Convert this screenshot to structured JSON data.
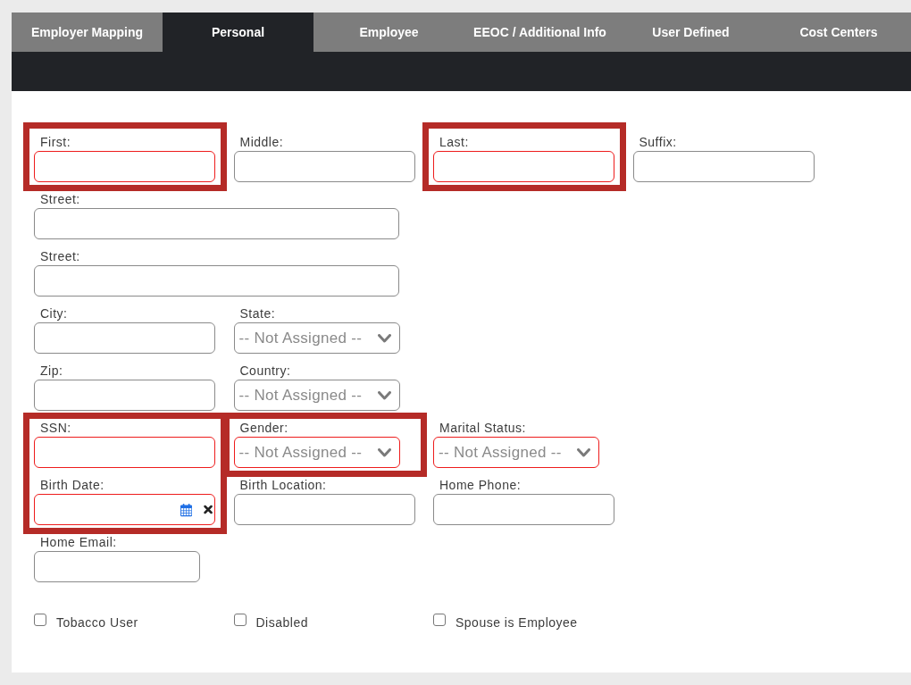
{
  "tabs": [
    {
      "label": "Employer Mapping",
      "selected": false
    },
    {
      "label": "Personal",
      "selected": true
    },
    {
      "label": "Employee",
      "selected": false
    },
    {
      "label": "EEOC / Additional Info",
      "selected": false
    },
    {
      "label": "User Defined",
      "selected": false
    },
    {
      "label": "Cost Centers",
      "selected": false
    }
  ],
  "form": {
    "rows": [
      {
        "fields": [
          {
            "kind": "text",
            "label": "First:",
            "required": true,
            "highlighted": true
          },
          {
            "kind": "text",
            "label": "Middle:",
            "required": false,
            "highlighted": false
          },
          {
            "kind": "text",
            "label": "Last:",
            "required": true,
            "highlighted": true
          },
          {
            "kind": "text",
            "label": "Suffix:",
            "required": false,
            "highlighted": false
          }
        ]
      },
      {
        "fields": [
          {
            "kind": "text",
            "label": "Street:",
            "required": false,
            "highlighted": false
          }
        ]
      },
      {
        "fields": [
          {
            "kind": "text",
            "label": "Street:",
            "required": false,
            "highlighted": false
          }
        ]
      },
      {
        "fields": [
          {
            "kind": "text",
            "label": "City:",
            "required": false,
            "highlighted": false
          },
          {
            "kind": "select",
            "label": "State:",
            "value": "-- Not Assigned --",
            "required": false,
            "highlighted": false
          }
        ]
      },
      {
        "fields": [
          {
            "kind": "text",
            "label": "Zip:",
            "required": false,
            "highlighted": false
          },
          {
            "kind": "select",
            "label": "Country:",
            "value": "-- Not Assigned --",
            "required": false,
            "highlighted": false
          }
        ]
      },
      {
        "fields": [
          {
            "kind": "text",
            "label": "SSN:",
            "required": true,
            "highlighted": true
          },
          {
            "kind": "select",
            "label": "Gender:",
            "value": "-- Not Assigned --",
            "required": true,
            "highlighted": true
          },
          {
            "kind": "select",
            "label": "Marital Status:",
            "value": "-- Not Assigned --",
            "required": true,
            "highlighted": false
          }
        ]
      },
      {
        "fields": [
          {
            "kind": "date",
            "label": "Birth Date:",
            "required": true,
            "highlighted": true
          },
          {
            "kind": "text",
            "label": "Birth Location:",
            "required": false,
            "highlighted": false
          },
          {
            "kind": "text",
            "label": "Home Phone:",
            "required": false,
            "highlighted": false
          }
        ]
      },
      {
        "fields": [
          {
            "kind": "text",
            "label": "Home Email:",
            "required": false,
            "highlighted": false
          }
        ]
      }
    ],
    "checkboxes": [
      {
        "label": "Tobacco User",
        "checked": false
      },
      {
        "label": "Disabled",
        "checked": false
      },
      {
        "label": "Spouse is Employee",
        "checked": false
      }
    ]
  }
}
